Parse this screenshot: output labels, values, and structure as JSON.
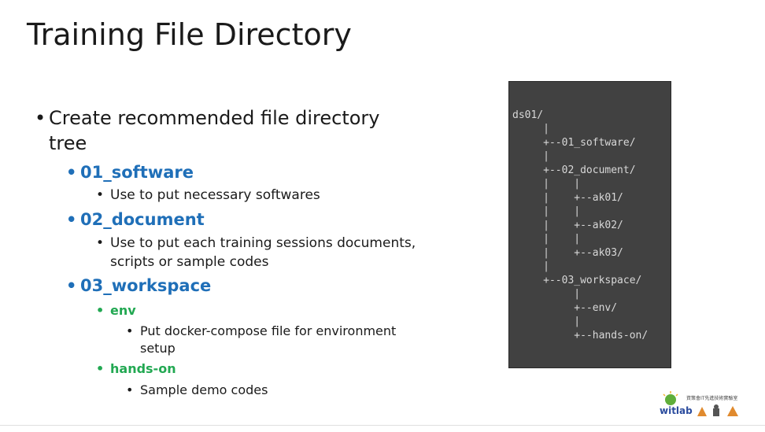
{
  "slide": {
    "title": "Training File Directory",
    "bullets": {
      "main_line1": "Create recommended file directory",
      "main_line2": "tree",
      "software": "01_software",
      "software_desc": "Use to put necessary softwares",
      "document": "02_document",
      "document_desc_line1": "Use to put each training sessions documents,",
      "document_desc_line2": "scripts or sample codes",
      "workspace": "03_workspace",
      "env": "env",
      "env_desc_line1": "Put docker-compose file for environment",
      "env_desc_line2": "setup",
      "handson": "hands-on",
      "handson_desc": "Sample demo codes"
    },
    "colors": {
      "blue": "#1f6fb8",
      "green": "#22a852",
      "terminal_bg": "#414141"
    }
  },
  "terminal": {
    "lines": [
      "ds01/",
      "     |",
      "     +--01_software/",
      "     |",
      "     +--02_document/",
      "     |    |",
      "     |    +--ak01/",
      "     |    |",
      "     |    +--ak02/",
      "     |    |",
      "     |    +--ak03/",
      "     |",
      "     +--03_workspace/",
      "          |",
      "          +--env/",
      "          |",
      "          +--hands-on/"
    ]
  },
  "logo": {
    "text": "witlab",
    "subtitle": "資策會IT先進技術實驗室",
    "icon": "witlab-logo-icon"
  }
}
